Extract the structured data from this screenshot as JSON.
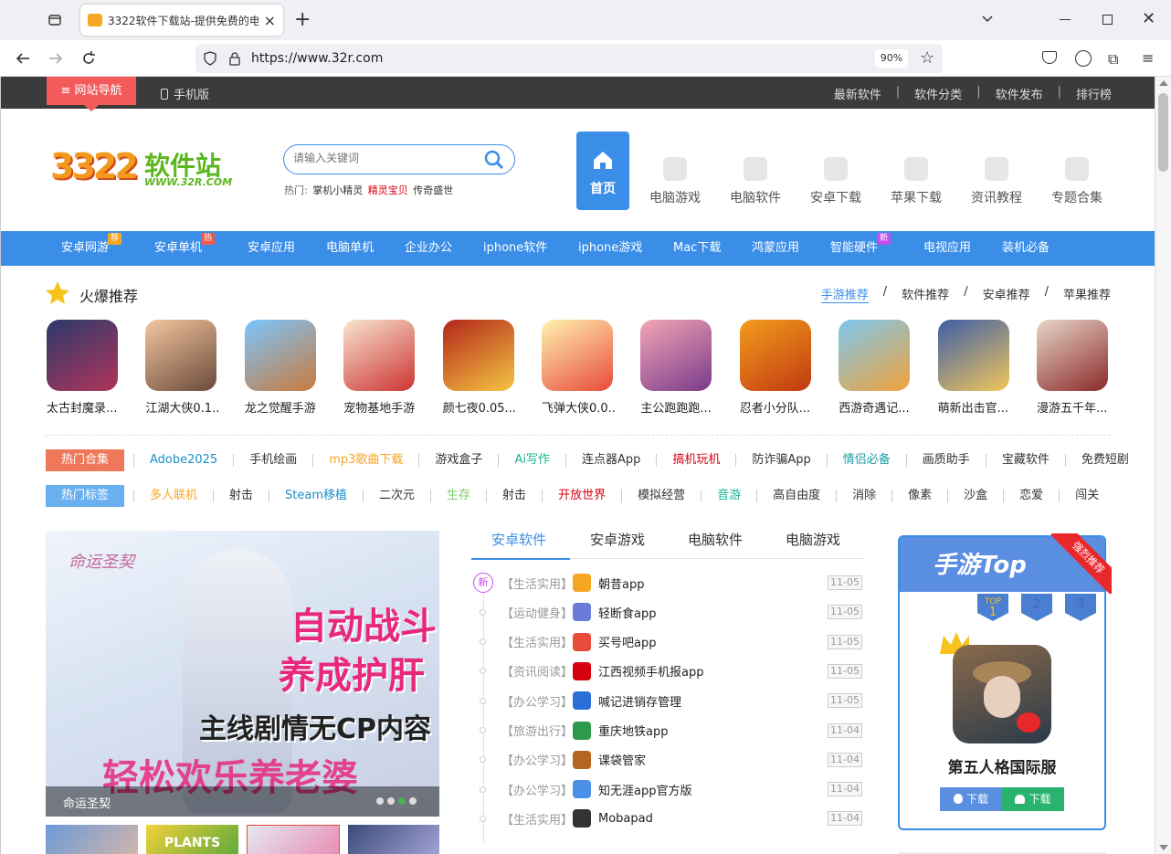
{
  "browser": {
    "tab_title": "3322软件下载站-提供免费的电",
    "url": "https://www.32r.com",
    "zoom": "90%"
  },
  "topbar": {
    "nav_label": "网站导航",
    "mobile_label": "手机版",
    "links": [
      "最新软件",
      "软件分类",
      "软件发布",
      "排行榜"
    ]
  },
  "logo": {
    "main": "3322",
    "cn": "软件站",
    "sub": "WWW.32R.COM"
  },
  "search": {
    "placeholder": "请输入关键词",
    "hot_label": "热门:",
    "hot": [
      "掌机小精灵",
      "精灵宝贝",
      "传奇盛世"
    ]
  },
  "mainnav": [
    {
      "label": "首页",
      "active": true
    },
    {
      "label": "电脑游戏"
    },
    {
      "label": "电脑软件"
    },
    {
      "label": "安卓下载"
    },
    {
      "label": "苹果下载"
    },
    {
      "label": "资讯教程"
    },
    {
      "label": "专题合集"
    }
  ],
  "categories": [
    {
      "label": "安卓网游",
      "badge": "荐",
      "color": "#f5a623"
    },
    {
      "label": "安卓单机",
      "badge": "热",
      "color": "#f05a4c"
    },
    {
      "label": "安卓应用"
    },
    {
      "label": "电脑单机"
    },
    {
      "label": "企业办公"
    },
    {
      "label": "iphone软件"
    },
    {
      "label": "iphone游戏"
    },
    {
      "label": "Mac下载"
    },
    {
      "label": "鸿蒙应用"
    },
    {
      "label": "智能硬件",
      "badge": "新",
      "color": "#c64ef0"
    },
    {
      "label": "电视应用"
    },
    {
      "label": "装机必备"
    }
  ],
  "hot": {
    "title": "火爆推荐",
    "tabs": [
      "手游推荐",
      "软件推荐",
      "安卓推荐",
      "苹果推荐"
    ],
    "apps": [
      {
        "name": "太古封魔录...",
        "c1": "#2b3a6b",
        "c2": "#b0345a"
      },
      {
        "name": "江湖大侠0.1...",
        "c1": "#f3c7a0",
        "c2": "#6b4a3a"
      },
      {
        "name": "龙之觉醒手游",
        "c1": "#7ac6ff",
        "c2": "#c97a3c"
      },
      {
        "name": "宠物基地手游",
        "c1": "#f9e5d0",
        "c2": "#c33"
      },
      {
        "name": "颜七夜0.05...",
        "c1": "#b2261a",
        "c2": "#f5c542"
      },
      {
        "name": "飞弹大侠0.0...",
        "c1": "#fff3b0",
        "c2": "#e84b3a"
      },
      {
        "name": "主公跑跑跑...",
        "c1": "#f2a6b6",
        "c2": "#7a3a8a"
      },
      {
        "name": "忍者小分队...",
        "c1": "#f39c1c",
        "c2": "#c03a10"
      },
      {
        "name": "西游奇遇记...",
        "c1": "#7cc8f0",
        "c2": "#f0a23a"
      },
      {
        "name": "萌新出击官...",
        "c1": "#3c5ea8",
        "c2": "#f2c65b"
      },
      {
        "name": "漫游五千年...",
        "c1": "#e8d6c8",
        "c2": "#8a2a2a"
      }
    ]
  },
  "tags": {
    "collection_label": "热门合集",
    "collection": [
      {
        "t": "Adobe2025",
        "c": "#1a8fc9"
      },
      {
        "t": "手机绘画",
        "c": "#333"
      },
      {
        "t": "mp3歌曲下载",
        "c": "#f5a623"
      },
      {
        "t": "游戏盒子",
        "c": "#333"
      },
      {
        "t": "Ai写作",
        "c": "#1ab394"
      },
      {
        "t": "连点器App",
        "c": "#333"
      },
      {
        "t": "搞机玩机",
        "c": "#d6000f"
      },
      {
        "t": "防诈骗App",
        "c": "#333"
      },
      {
        "t": "情侣必备",
        "c": "#1a9fa6"
      },
      {
        "t": "画质助手",
        "c": "#333"
      },
      {
        "t": "宝藏软件",
        "c": "#333"
      },
      {
        "t": "免费短剧",
        "c": "#333"
      }
    ],
    "tag_label": "热门标签",
    "tags": [
      {
        "t": "多人联机",
        "c": "#f5a623"
      },
      {
        "t": "射击",
        "c": "#333"
      },
      {
        "t": "Steam移植",
        "c": "#1a8fc9"
      },
      {
        "t": "二次元",
        "c": "#333"
      },
      {
        "t": "生存",
        "c": "#7ecb6a"
      },
      {
        "t": "射击",
        "c": "#333"
      },
      {
        "t": "开放世界",
        "c": "#d6000f"
      },
      {
        "t": "模拟经营",
        "c": "#333"
      },
      {
        "t": "音游",
        "c": "#1ab394"
      },
      {
        "t": "高自由度",
        "c": "#333"
      },
      {
        "t": "消除",
        "c": "#333"
      },
      {
        "t": "像素",
        "c": "#333"
      },
      {
        "t": "沙盒",
        "c": "#333"
      },
      {
        "t": "恋爱",
        "c": "#333"
      },
      {
        "t": "闯关",
        "c": "#333"
      }
    ]
  },
  "banner": {
    "logo": "命运圣契",
    "line1": "自动战斗",
    "line2": "养成护肝",
    "line3": "主线剧情无CP内容",
    "line4": "轻松欢乐养老婆",
    "caption": "命运圣契",
    "thumb_text": "PLANTS"
  },
  "list": {
    "tabs": [
      "安卓软件",
      "安卓游戏",
      "电脑软件",
      "电脑游戏"
    ],
    "new_label": "新",
    "items": [
      {
        "cat": "【生活实用】",
        "name": "朝昔app",
        "date": "11-05",
        "c": "#f5a623"
      },
      {
        "cat": "【运动健身】",
        "name": "轻断食app",
        "date": "11-05",
        "c": "#6a7bd8"
      },
      {
        "cat": "【生活实用】",
        "name": "买号吧app",
        "date": "11-05",
        "c": "#e84b3a"
      },
      {
        "cat": "【资讯阅读】",
        "name": "江西视频手机报app",
        "date": "11-05",
        "c": "#d6000f"
      },
      {
        "cat": "【办公学习】",
        "name": "喊记进销存管理",
        "date": "11-05",
        "c": "#2a6ed8"
      },
      {
        "cat": "【旅游出行】",
        "name": "重庆地铁app",
        "date": "11-04",
        "c": "#2c9a4a"
      },
      {
        "cat": "【办公学习】",
        "name": "课袋管家",
        "date": "11-04",
        "c": "#b5651d"
      },
      {
        "cat": "【办公学习】",
        "name": "知无涯app官方版",
        "date": "11-04",
        "c": "#4a8fe8"
      },
      {
        "cat": "【生活实用】",
        "name": "Mobapad",
        "date": "11-04",
        "c": "#333"
      }
    ]
  },
  "side": {
    "title": "手游Top",
    "ribbon": "强烈推荐",
    "ranks": [
      "TOP",
      "1",
      "2",
      "3"
    ],
    "game": "第五人格国际服",
    "btn_ios": "下载",
    "btn_android": "下载"
  }
}
